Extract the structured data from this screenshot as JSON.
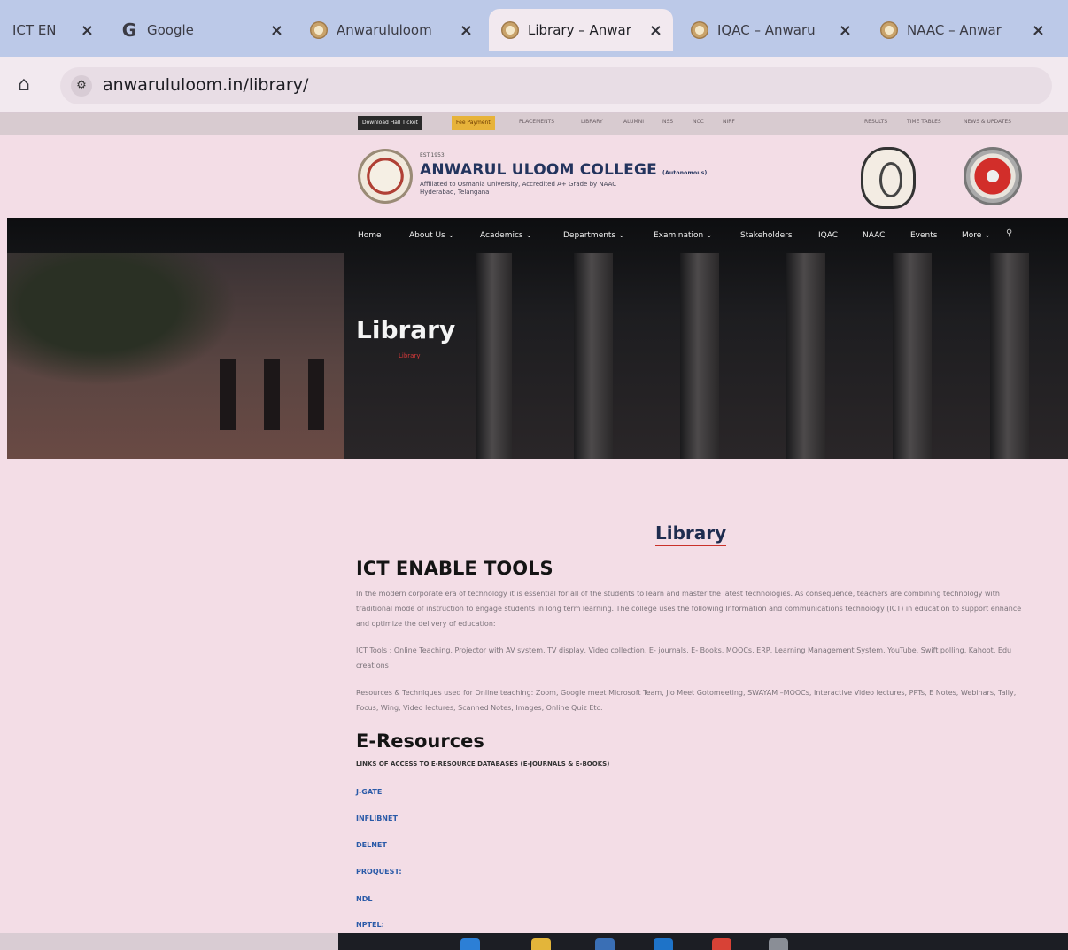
{
  "browser": {
    "tabs": [
      {
        "title": "ICT EN",
        "icon": "page-icon",
        "active": false
      },
      {
        "title": "Google",
        "icon": "google-icon",
        "active": false
      },
      {
        "title": "Anwarululoom",
        "icon": "college-logo-icon",
        "active": false
      },
      {
        "title": "Library – Anwar",
        "icon": "college-logo-icon",
        "active": true
      },
      {
        "title": "IQAC – Anwaru",
        "icon": "college-logo-icon",
        "active": false
      },
      {
        "title": "NAAC – Anwar",
        "icon": "college-logo-icon",
        "active": false
      }
    ],
    "close_glyph": "×",
    "url": "anwarululoom.in/library/"
  },
  "site": {
    "topbar": {
      "download_btn": "Download Hall Ticket",
      "fee_btn": "Fee Payment",
      "links": [
        "PLACEMENTS",
        "LIBRARY",
        "ALUMNI",
        "NSS",
        "NCC",
        "NIRF"
      ],
      "right_links": [
        "RESULTS",
        "TIME TABLES",
        "NEWS & UPDATES"
      ]
    },
    "brand": {
      "est": "EST.1953",
      "name": "ANWARUL ULOOM COLLEGE",
      "autonomous": "(Autonomous)",
      "affiliation_line1": "Affiliated to Osmania University, Accredited A+ Grade by NAAC",
      "affiliation_line2": "Hyderabad, Telangana"
    },
    "nav": {
      "items": [
        "Home",
        "About Us ⌄",
        "Academics ⌄",
        "Departments ⌄",
        "Examination ⌄",
        "Stakeholders",
        "IQAC",
        "NAAC",
        "Events",
        "More ⌄"
      ],
      "search_glyph": "⚲"
    },
    "hero": {
      "title": "Library",
      "crumb": "Library"
    }
  },
  "content": {
    "heading": "Library",
    "ict_title": "ICT ENABLE TOOLS",
    "ict_para1": "In the modern corporate era of technology it is essential for all of the students to learn and master the latest technologies. As consequence, teachers are combining technology with traditional mode of instruction to engage students in long term learning. The college uses the following Information and communications technology (ICT) in education to support enhance and optimize the delivery of education:",
    "ict_para2": "ICT Tools : Online Teaching, Projector with AV system, TV display, Video collection, E- journals, E- Books, MOOCs, ERP, Learning Management System, YouTube, Swift polling, Kahoot, Edu creations",
    "ict_para3": "Resources & Techniques used for Online teaching: Zoom, Google meet Microsoft Team, Jio Meet Gotomeeting, SWAYAM –MOOCs, Interactive Video lectures, PPTs, E Notes, Webinars, Tally, Focus, Wing, Video lectures, Scanned Notes, Images, Online Quiz Etc.",
    "eres_title": "E-Resources",
    "links_heading": "LINKS OF ACCESS TO E-RESOURCE DATABASES (E-JOURNALS & E-BOOKS)",
    "links": [
      "J-GATE",
      "INFLIBNET",
      "DELNET",
      "PROQUEST:",
      "NDL",
      "NPTEL:"
    ]
  },
  "colors": {
    "page_bg": "#f3dde6",
    "tab_strip": "#bcc9e8",
    "heading_navy": "#1e2c4f",
    "underline_red": "#c9312a",
    "link_blue": "#2a5aa8"
  }
}
